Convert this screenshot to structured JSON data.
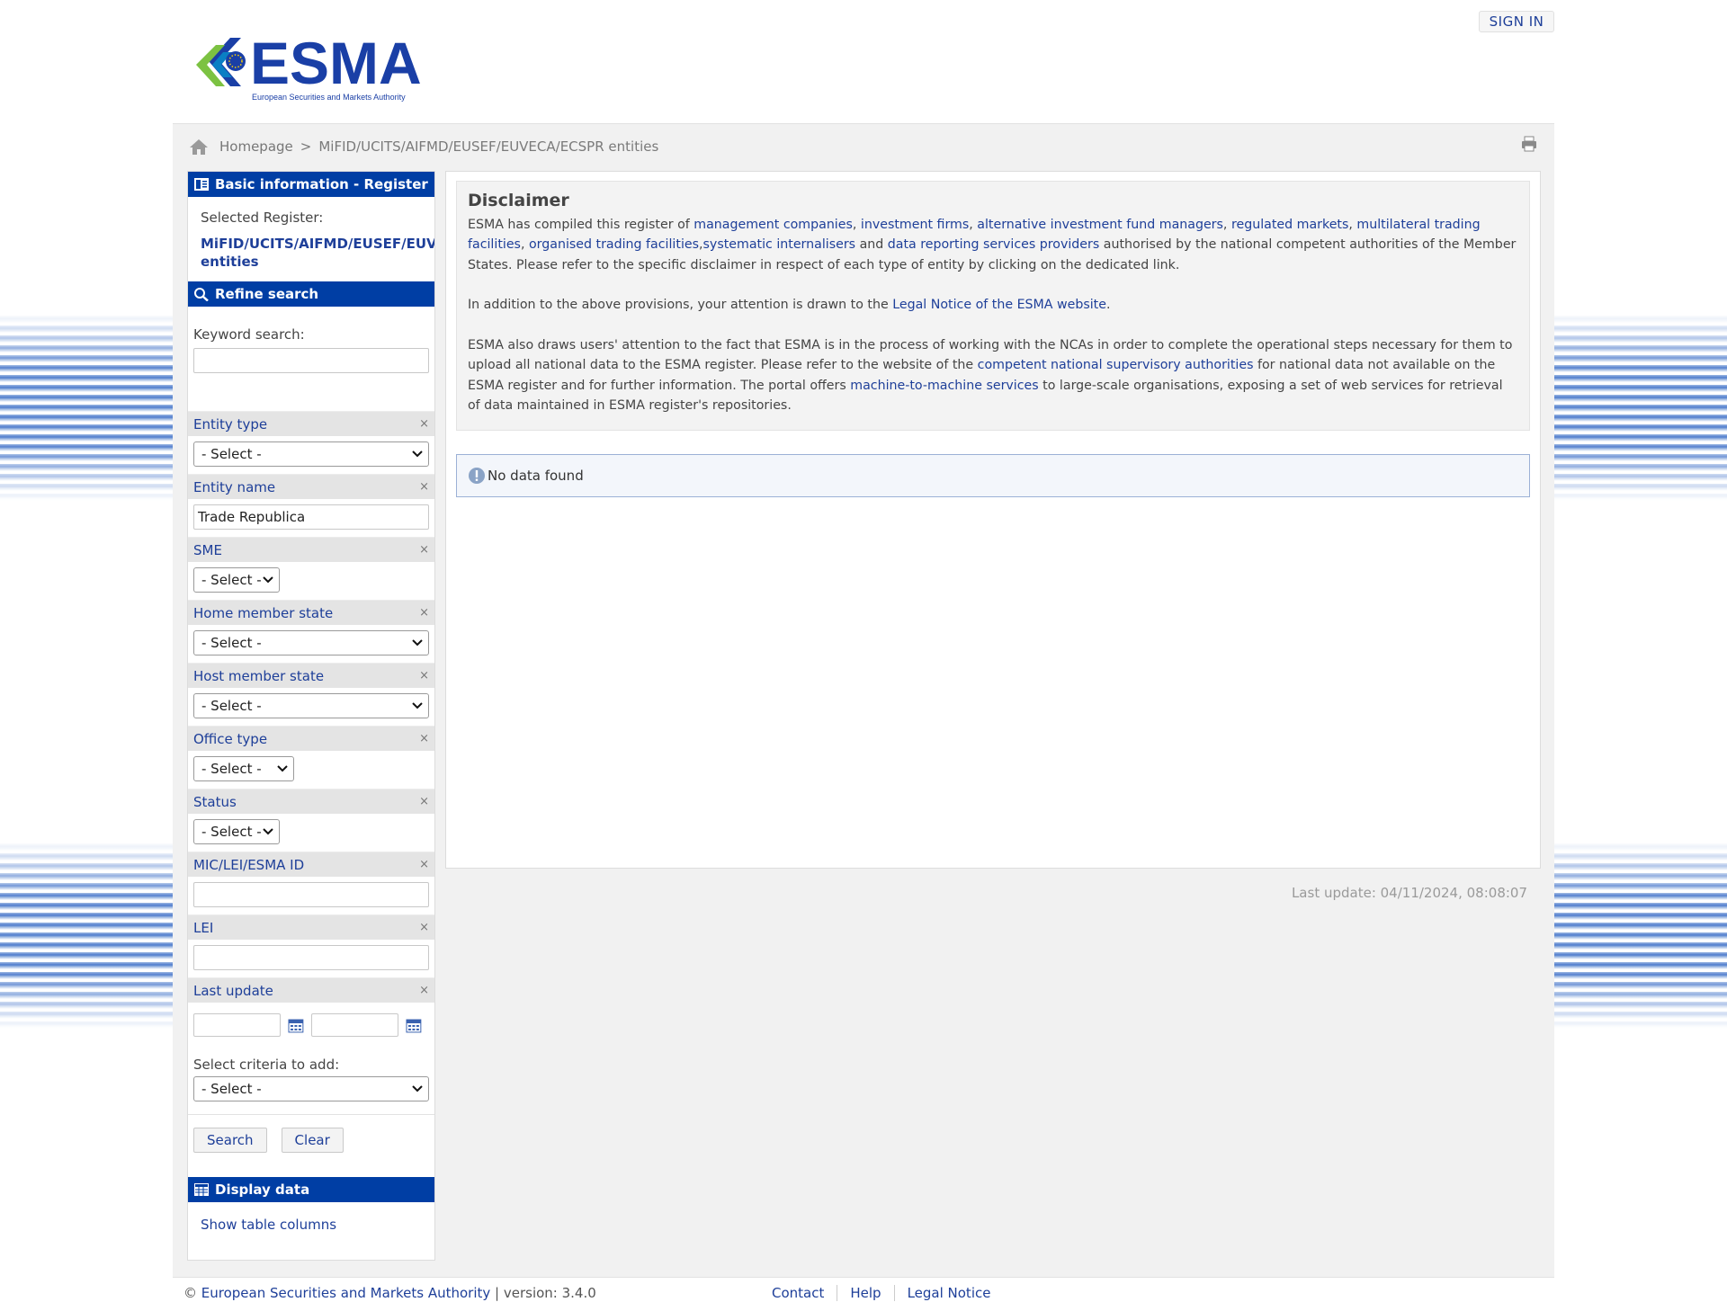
{
  "header": {
    "signin_label": "SIGN IN",
    "logo_text": "ESMA",
    "logo_subtext": "European Securities and Markets Authority"
  },
  "breadcrumb": {
    "home": "Homepage",
    "separator": ">",
    "current": "MiFID/UCITS/AIFMD/EUSEF/EUVECA/ECSPR entities"
  },
  "sidebar": {
    "basic_info_title": "Basic information - Register",
    "selected_register_label": "Selected Register:",
    "selected_register_line1": "MiFID/UCITS/AIFMD/EUSEF/EUVECA/ECSPR",
    "selected_register_line2": "entities",
    "refine_title": "Refine search",
    "keyword_label": "Keyword search:",
    "keyword_value": "",
    "criteria": {
      "entity_type": {
        "label": "Entity type",
        "value": "- Select -"
      },
      "entity_name": {
        "label": "Entity name",
        "value": "Trade Republica"
      },
      "sme": {
        "label": "SME",
        "value": "- Select -"
      },
      "home_member_state": {
        "label": "Home member state",
        "value": "- Select -"
      },
      "host_member_state": {
        "label": "Host member state",
        "value": "- Select -"
      },
      "office_type": {
        "label": "Office type",
        "value": "- Select -"
      },
      "status": {
        "label": "Status",
        "value": "- Select -"
      },
      "mic_lei_esma": {
        "label": "MIC/LEI/ESMA ID",
        "value": ""
      },
      "lei": {
        "label": "LEI",
        "value": ""
      },
      "last_update": {
        "label": "Last update",
        "from": "",
        "to": ""
      }
    },
    "remove_glyph": "×",
    "add_criteria_label": "Select criteria to add:",
    "add_criteria_value": "- Select -",
    "search_button": "Search",
    "clear_button": "Clear",
    "display_title": "Display data",
    "show_columns_link": "Show table columns"
  },
  "disclaimer": {
    "title": "Disclaimer",
    "p1": {
      "t1": "ESMA has compiled this register of ",
      "l1": "management companies",
      "t2": ", ",
      "l2": "investment firms",
      "t3": ", ",
      "l3": "alternative investment fund managers",
      "t4": ", ",
      "l4": "regulated markets",
      "t5": ", ",
      "l5": "multilateral trading facilities",
      "t6": ", ",
      "l6": "organised trading facilities",
      "t7": ",",
      "l7": "systematic internalisers",
      "t8": " and ",
      "l8": "data reporting services providers",
      "t9": " authorised by the national competent authorities of the Member States. Please refer to the specific disclaimer in respect of each type of entity by clicking on the dedicated link."
    },
    "p2": {
      "t1": "In addition to the above provisions, your attention is drawn to the ",
      "l1": "Legal Notice of the ESMA website",
      "t2": "."
    },
    "p3": {
      "t1": "ESMA also draws users' attention to the fact that ESMA is in the process of working with the NCAs in order to complete the operational steps necessary for them to upload all national data to the ESMA register. Please refer to the website of the ",
      "l1": "competent national supervisory authorities",
      "t2": " for national data not available on the ESMA register and for further information. The portal offers ",
      "l2": "machine-to-machine services",
      "t3": " to large-scale organisations, exposing a set of web services for retrieval of data maintained in ESMA register's repositories."
    }
  },
  "results": {
    "no_data": "No data found",
    "last_update": "Last update: 04/11/2024, 08:08:07"
  },
  "footer": {
    "copyright": "©",
    "org": "European Securities and Markets Authority",
    "version": " | version: 3.4.0",
    "links": [
      "Contact",
      "Help",
      "Legal Notice"
    ]
  },
  "colors": {
    "brand_blue": "#003ea4",
    "link_blue": "#1e3f99",
    "logo_green": "#7cc242"
  }
}
